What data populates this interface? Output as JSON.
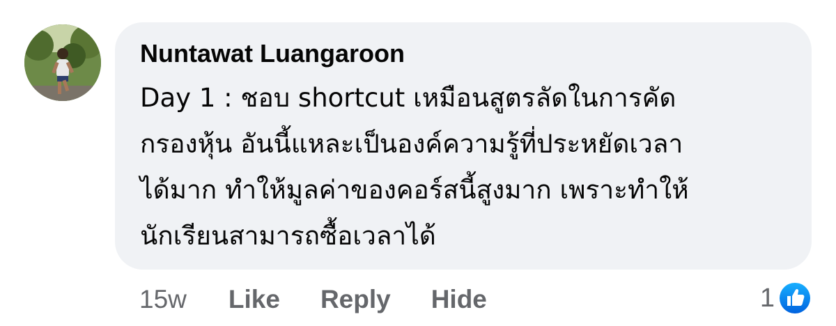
{
  "comment": {
    "author": "Nuntawat Luangaroon",
    "text_lines": [
      "Day 1 : ชอบ shortcut เหมือนสูตรลัดในการคัด",
      "กรองหุ้น อันนี้แหละเป็นองค์ความรู้ที่ประหยัดเวลา",
      "ได้มาก ทำให้มูลค่าของคอร์สนี้สูงมาก เพราะทำให้",
      "นักเรียนสามารถซื้อเวลาได้"
    ],
    "bubble_color": "#f0f2f5"
  },
  "actions": {
    "timestamp": "15w",
    "like_label": "Like",
    "reply_label": "Reply",
    "hide_label": "Hide"
  },
  "reactions": {
    "count": "1",
    "icon": "like-icon",
    "color": "#1877f2"
  },
  "colors": {
    "text_primary": "#050505",
    "text_secondary": "#65676b",
    "accent": "#1877f2"
  }
}
